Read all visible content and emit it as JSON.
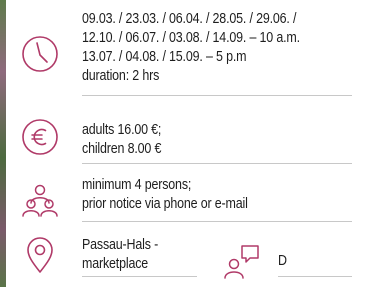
{
  "accent_color": "#b03a68",
  "schedule": {
    "icon": "clock-icon",
    "lines": [
      "09.03. / 23.03. / 06.04. / 28.05. / 29.06. /",
      "12.10. / 06.07. / 03.08. / 14.09. – 10 a.m.",
      "13.07. / 04.08. / 15.09. – 5 p.m",
      "duration: 2 hrs"
    ]
  },
  "price": {
    "icon": "euro-icon",
    "lines": [
      "adults 16.00 €;",
      "children 8.00 €"
    ]
  },
  "group": {
    "icon": "group-icon",
    "lines": [
      "minimum 4 persons;",
      "prior notice via phone or e-mail"
    ]
  },
  "location": {
    "icon": "location-pin-icon",
    "lines": [
      "Passau-Hals -",
      "marketplace"
    ]
  },
  "language": {
    "icon": "speech-person-icon",
    "value": "D"
  }
}
